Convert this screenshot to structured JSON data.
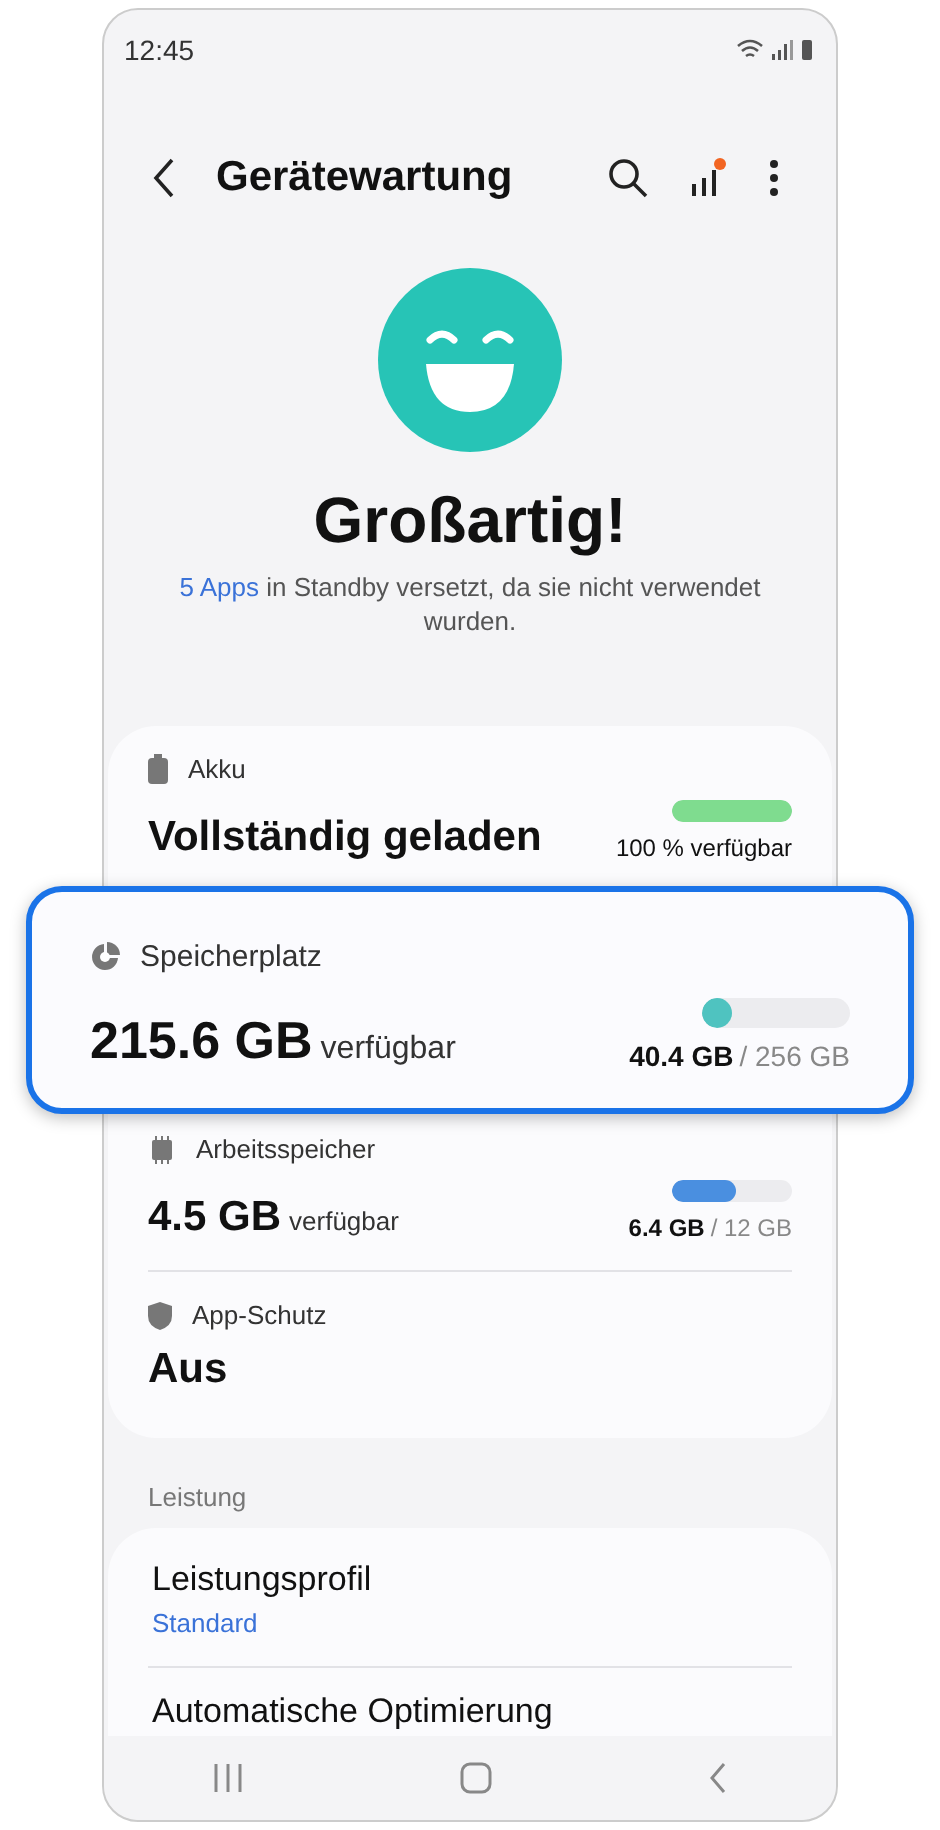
{
  "status_bar": {
    "time": "12:45"
  },
  "header": {
    "title": "Gerätewartung",
    "notification_dot": true
  },
  "hero": {
    "title": "Großartig!",
    "link": "5 Apps",
    "message": " in Standby versetzt, da sie nicht verwendet wurden."
  },
  "items": [
    {
      "kind": "bar",
      "highlighted": false,
      "label": "Akku",
      "value": "Vollständig geladen",
      "level": 1,
      "color": "#7fdc8f",
      "reading": "100 % verfügbar"
    },
    {
      "kind": "usage",
      "highlighted": true,
      "label": "Speicherplatz",
      "value": "215.6 GB",
      "unit": "verfügbar",
      "level": 0.18,
      "color": "#4fc3c0",
      "used": "40.4 GB",
      "total": "/ 256 GB"
    },
    {
      "kind": "usage",
      "highlighted": false,
      "label": "Arbeitsspeicher",
      "value": "4.5 GB",
      "unit": "verfügbar",
      "level": 0.53,
      "color": "#4a8fe0",
      "used": "6.4 GB",
      "total": "/ 12 GB"
    },
    {
      "kind": "text",
      "highlighted": false,
      "label": "App-Schutz",
      "value": "Aus"
    }
  ],
  "section": {
    "title": "Leistung",
    "rows": [
      {
        "title": "Leistungsprofil",
        "subtitle": "Standard"
      },
      {
        "title": "Automatische Optimierung"
      }
    ]
  }
}
